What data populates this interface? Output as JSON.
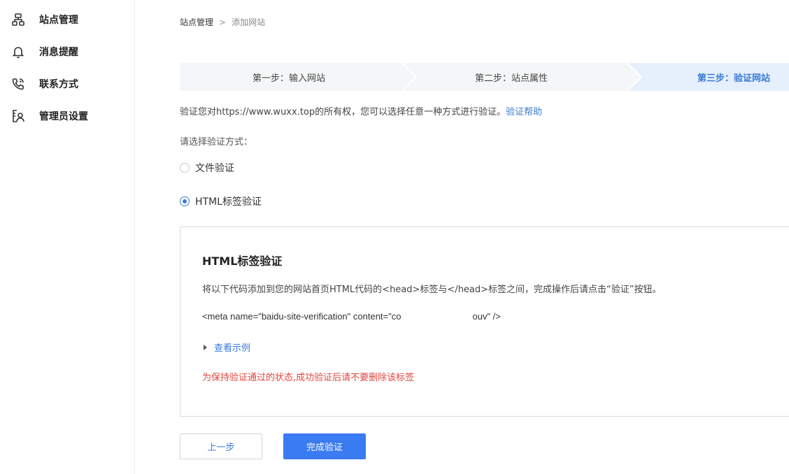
{
  "sidebar": {
    "items": [
      {
        "label": "站点管理",
        "icon": "sitemap-icon"
      },
      {
        "label": "消息提醒",
        "icon": "bell-icon"
      },
      {
        "label": "联系方式",
        "icon": "phone-icon"
      },
      {
        "label": "管理员设置",
        "icon": "admin-user-icon"
      }
    ]
  },
  "breadcrumb": {
    "root": "站点管理",
    "separator": ">",
    "current": "添加网站"
  },
  "steps": [
    {
      "label": "第一步：输入网站",
      "state": "done"
    },
    {
      "label": "第二步：站点属性",
      "state": "done"
    },
    {
      "label": "第三步：验证网站",
      "state": "active"
    }
  ],
  "verify": {
    "description": "验证您对https://www.wuxx.top的所有权，您可以选择任意一种方式进行验证。",
    "help_link": "验证帮助",
    "choose_label": "请选择验证方式：",
    "options": [
      {
        "label": "文件验证",
        "checked": false
      },
      {
        "label": "HTML标签验证",
        "checked": true
      }
    ]
  },
  "panel": {
    "title": "HTML标签验证",
    "instruction": "将以下代码添加到您的网站首页HTML代码的<head>标签与</head>标签之间，完成操作后请点击“验证”按钮。",
    "code_start": "<meta name=\"baidu-site-verification\" content=\"co",
    "code_end": "ouv\" />",
    "example_link": "查看示例",
    "warning": "为保持验证通过的状态,成功验证后请不要删除该标签"
  },
  "buttons": {
    "prev": "上一步",
    "finish": "完成验证"
  },
  "colors": {
    "accent": "#3a7bd5",
    "primary_button": "#3a7bf2",
    "warning": "#e0463f",
    "step_bg": "#f5f6f7",
    "step_active_bg": "#e6effc"
  }
}
